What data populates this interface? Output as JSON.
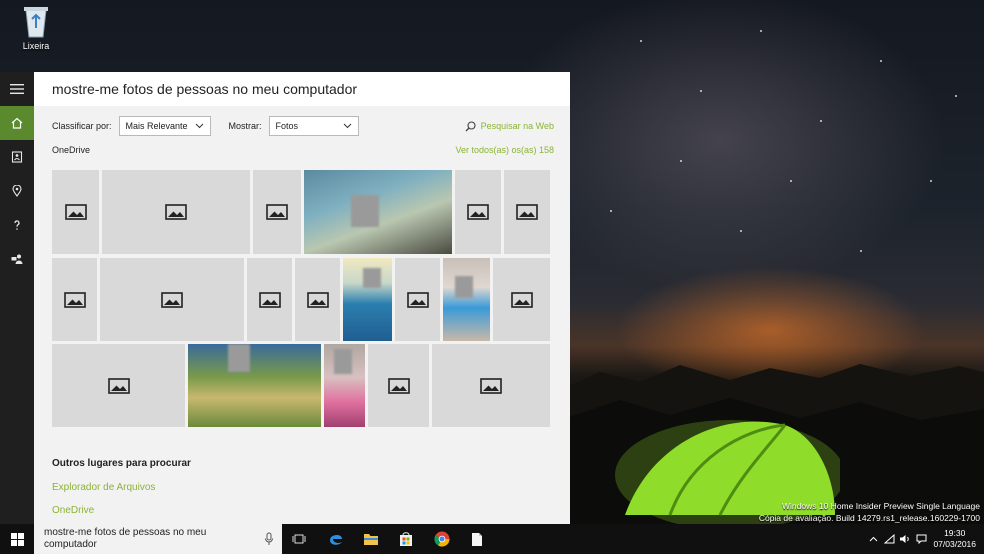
{
  "desktop": {
    "recycle_bin_label": "Lixeira",
    "watermark_line1": "Windows 10 Home Insider Preview Single Language",
    "watermark_line2": "Cópia de avaliação. Build 14279.rs1_release.160229-1700"
  },
  "cortana": {
    "query": "mostre-me fotos de pessoas no meu computador",
    "sort_label": "Classificar por:",
    "sort_value": "Mais Relevante",
    "show_label": "Mostrar:",
    "show_value": "Fotos",
    "web_search": "Pesquisar na Web",
    "source": "OneDrive",
    "see_all": "Ver todos(as) os(as) 158",
    "other_places_title": "Outros lugares para procurar",
    "other_places": [
      "Explorador de Arquivos",
      "OneDrive"
    ]
  },
  "taskbar": {
    "search_text": "mostre-me fotos de pessoas no meu computador",
    "time": "19:30",
    "date": "07/03/2016"
  },
  "colors": {
    "accent_green": "#8ab434",
    "rail_active": "#5a8a2d",
    "tile_gray": "#d9d9d9"
  },
  "icons": [
    "hamburger-icon",
    "home-icon",
    "notebook-icon",
    "location-icon",
    "help-icon",
    "feedback-icon",
    "search-icon",
    "picture-placeholder-icon",
    "windows-logo-icon",
    "microphone-icon",
    "task-view-icon",
    "edge-icon",
    "file-explorer-icon",
    "store-icon",
    "chrome-icon",
    "document-icon",
    "chevron-up-icon",
    "network-icon",
    "volume-icon",
    "notification-icon"
  ]
}
